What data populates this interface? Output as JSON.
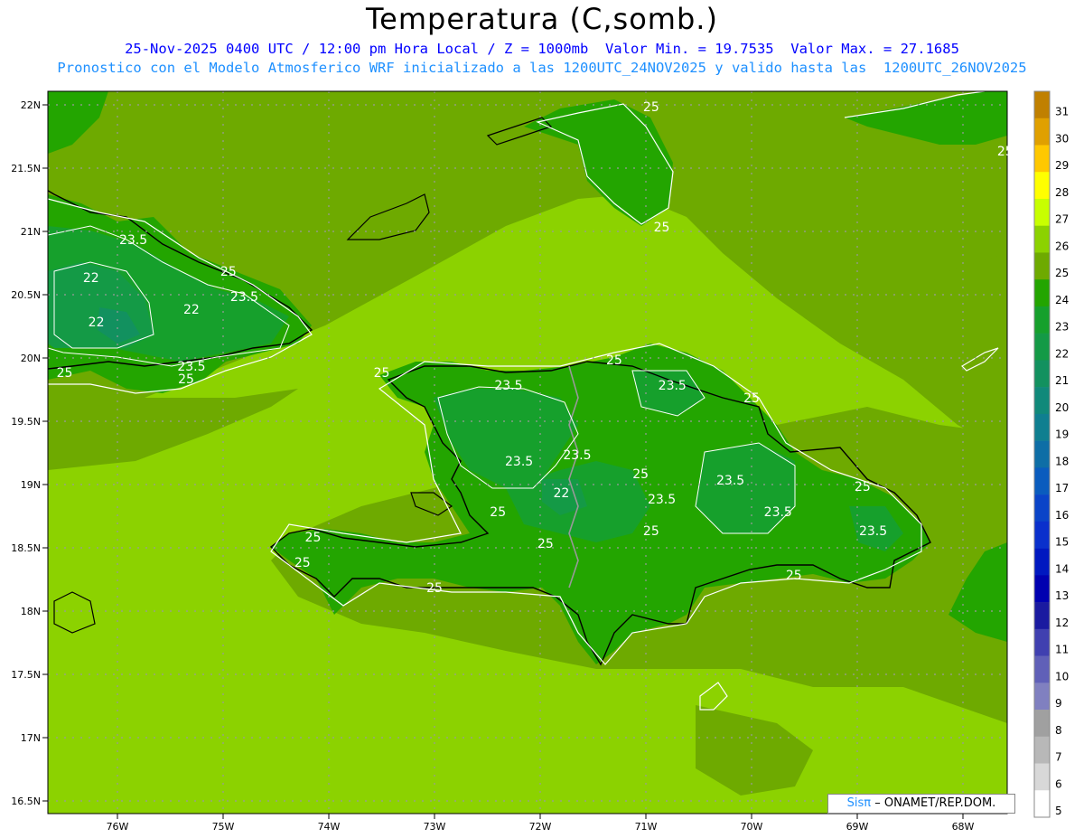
{
  "header": {
    "title": "Temperatura (C,somb.)",
    "line1": "25-Nov-2025 0400 UTC / 12:00 pm Hora Local / Z = 1000mb  Valor Min. = 19.7535  Valor Max. = 27.1685",
    "line2": "Pronostico con el Modelo Atmosferico WRF inicializado a las 1200UTC_24NOV2025 y valido hasta las  1200UTC_26NOV2025"
  },
  "credit": {
    "brand": "Sisπ",
    "org": "– ONAMET/REP.DOM."
  },
  "axes": {
    "lon_labels": [
      "76W",
      "75W",
      "74W",
      "73W",
      "72W",
      "71W",
      "70W",
      "69W",
      "68W"
    ],
    "lat_labels": [
      "22N",
      "21.5N",
      "21N",
      "20.5N",
      "20N",
      "19.5N",
      "19N",
      "18.5N",
      "18N",
      "17.5N",
      "17N",
      "16.5N"
    ]
  },
  "colorbar": {
    "labels": [
      "31",
      "30",
      "29",
      "28",
      "27",
      "26",
      "25",
      "24",
      "23",
      "22",
      "21",
      "20",
      "19",
      "18",
      "17",
      "16",
      "15",
      "14",
      "13",
      "12",
      "11",
      "10",
      "9",
      "8",
      "7",
      "6",
      "5"
    ],
    "colors": [
      "#c08000",
      "#e0a000",
      "#ffc800",
      "#ffff00",
      "#c8ff00",
      "#8cd200",
      "#6eaa00",
      "#23a500",
      "#16a02c",
      "#149a46",
      "#12915f",
      "#10897a",
      "#0f7f90",
      "#0e6ea6",
      "#0a5cbe",
      "#0a44c8",
      "#0a30cc",
      "#0018c0",
      "#0000b0",
      "#1a1aa0",
      "#4040b0",
      "#6060b8",
      "#8080c0",
      "#a0a0a0",
      "#b8b8b8",
      "#d8d8d8",
      "#ffffff"
    ]
  },
  "contour_labels": [
    {
      "text": "25",
      "lon": -70.95,
      "lat": 21.95
    },
    {
      "text": "25",
      "lon": -67.6,
      "lat": 21.6
    },
    {
      "text": "25",
      "lon": -70.85,
      "lat": 21.0
    },
    {
      "text": "23.5",
      "lon": -75.85,
      "lat": 20.9
    },
    {
      "text": "25",
      "lon": -74.95,
      "lat": 20.65
    },
    {
      "text": "22",
      "lon": -76.25,
      "lat": 20.6
    },
    {
      "text": "23.5",
      "lon": -74.8,
      "lat": 20.45
    },
    {
      "text": "22",
      "lon": -75.3,
      "lat": 20.35
    },
    {
      "text": "22",
      "lon": -76.2,
      "lat": 20.25
    },
    {
      "text": "23.5",
      "lon": -75.3,
      "lat": 19.9
    },
    {
      "text": "25",
      "lon": -75.35,
      "lat": 19.8
    },
    {
      "text": "25",
      "lon": -76.5,
      "lat": 19.85
    },
    {
      "text": "25",
      "lon": -71.3,
      "lat": 19.95
    },
    {
      "text": "25",
      "lon": -73.5,
      "lat": 19.85
    },
    {
      "text": "23.5",
      "lon": -72.3,
      "lat": 19.75
    },
    {
      "text": "23.5",
      "lon": -70.75,
      "lat": 19.75
    },
    {
      "text": "25",
      "lon": -70.0,
      "lat": 19.65
    },
    {
      "text": "23.5",
      "lon": -72.2,
      "lat": 19.15
    },
    {
      "text": "23.5",
      "lon": -71.65,
      "lat": 19.2
    },
    {
      "text": "25",
      "lon": -71.05,
      "lat": 19.05
    },
    {
      "text": "23.5",
      "lon": -70.2,
      "lat": 19.0
    },
    {
      "text": "22",
      "lon": -71.8,
      "lat": 18.9
    },
    {
      "text": "23.5",
      "lon": -70.85,
      "lat": 18.85
    },
    {
      "text": "25",
      "lon": -68.95,
      "lat": 18.95
    },
    {
      "text": "25",
      "lon": -72.4,
      "lat": 18.75
    },
    {
      "text": "23.5",
      "lon": -69.75,
      "lat": 18.75
    },
    {
      "text": "25",
      "lon": -70.95,
      "lat": 18.6
    },
    {
      "text": "23.5",
      "lon": -68.85,
      "lat": 18.6
    },
    {
      "text": "25",
      "lon": -74.15,
      "lat": 18.55
    },
    {
      "text": "25",
      "lon": -71.95,
      "lat": 18.5
    },
    {
      "text": "25",
      "lon": -74.25,
      "lat": 18.35
    },
    {
      "text": "25",
      "lon": -69.6,
      "lat": 18.25
    },
    {
      "text": "25",
      "lon": -73.0,
      "lat": 18.15
    }
  ]
}
